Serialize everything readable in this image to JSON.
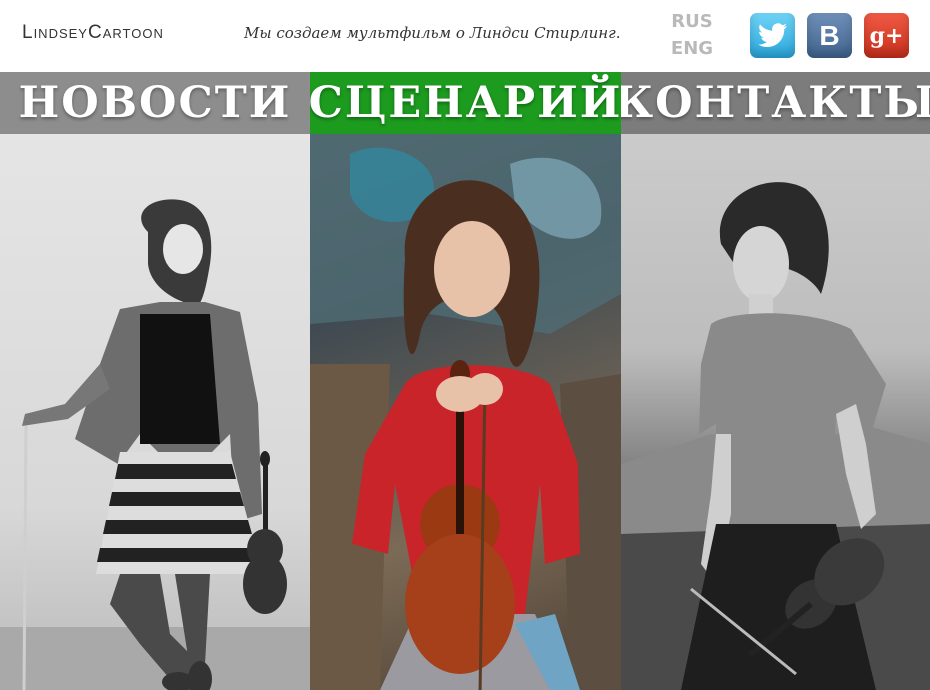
{
  "header": {
    "logo": "LindseyCartoon",
    "tagline": "Мы создаем мультфильм о Линдси Стирлинг.",
    "languages": [
      "RUS",
      "ENG"
    ]
  },
  "social": [
    {
      "name": "twitter",
      "icon": "twitter-bird-icon",
      "color": "#2aa9e0"
    },
    {
      "name": "vk",
      "icon": "vk-icon",
      "label": "B",
      "color": "#41648f"
    },
    {
      "name": "google-plus",
      "icon": "google-plus-icon",
      "label": "g+",
      "color": "#c9301c"
    }
  ],
  "nav": [
    {
      "label": "НОВОСТИ",
      "color": "#8d8d8d"
    },
    {
      "label": "СЦЕНАРИЙ",
      "color": "#1c9b1f"
    },
    {
      "label": "КОНТАКТЫ",
      "color": "#7c7c7c"
    }
  ],
  "photos": [
    {
      "desc_icon": "violinist-photo-bw-striped-skirt"
    },
    {
      "desc_icon": "violinist-photo-color-red-top"
    },
    {
      "desc_icon": "violinist-photo-bw-field"
    }
  ]
}
